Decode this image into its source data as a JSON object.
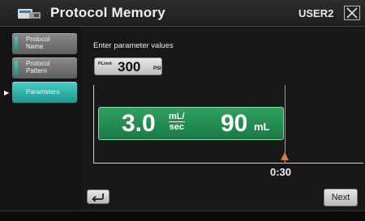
{
  "header": {
    "title": "Protocol Memory",
    "user": "USER2",
    "icon": "protocol-memory-icon"
  },
  "sidebar": {
    "items": [
      {
        "label_line1": "Protocol",
        "label_line2": "Name",
        "active": false
      },
      {
        "label_line1": "Protocol",
        "label_line2": "Pattern",
        "active": false
      },
      {
        "label_line1": "Parameters",
        "label_line2": "",
        "active": true
      }
    ],
    "active_indicator": "▶"
  },
  "main": {
    "instruction": "Enter parameter values",
    "pressure": {
      "tag": "PLimit",
      "value": "300",
      "unit": "PSI"
    },
    "phase": {
      "rate": "3.0",
      "rate_unit_top": "mL/",
      "rate_unit_bottom": "sec",
      "volume": "90",
      "volume_unit": "mL"
    },
    "time": "0:30",
    "next_label": "Next"
  },
  "colors": {
    "accent": "#2fb3ac",
    "phase_bar": "#1f8a50",
    "marker": "#e07a3a"
  }
}
